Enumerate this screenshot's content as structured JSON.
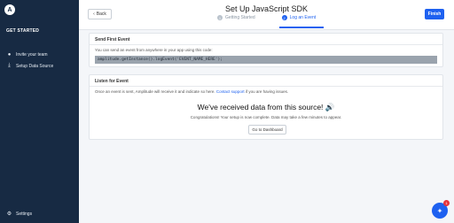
{
  "sidebar": {
    "heading": "GET STARTED",
    "items": [
      {
        "label": "Invite your team",
        "icon": "user-icon"
      },
      {
        "label": "Setup Data Source",
        "icon": "download-icon"
      }
    ],
    "settings_label": "Settings"
  },
  "header": {
    "back_label": "Back",
    "title": "Set Up JavaScript SDK",
    "steps": [
      {
        "num": "1",
        "label": "Getting Started",
        "active": false
      },
      {
        "num": "2",
        "label": "Log an Event",
        "active": true
      }
    ],
    "finish_label": "Finish"
  },
  "send_event": {
    "title": "Send First Event",
    "description": "You can send an event from anywhere in your app using this code:",
    "code": "amplitude.getInstance().logEvent('EVENT_NAME_HERE');"
  },
  "listen_event": {
    "title": "Listen for Event",
    "description_before": "Once an event is sent, Amplitude will receive it and indicate so here.",
    "link": "Contact support",
    "description_after": "if you are having issues.",
    "received": "We've received data from this source!",
    "received_icon": "🔊",
    "congrats": "Congratulations! Your setup is now complete. Data may take a few minutes to appear.",
    "dashboard_button": "Go to Dashboard"
  },
  "chat": {
    "badge": "1"
  },
  "colors": {
    "sidebar": "#172a43",
    "accent": "#1e61f0",
    "badge": "#e8333a"
  }
}
